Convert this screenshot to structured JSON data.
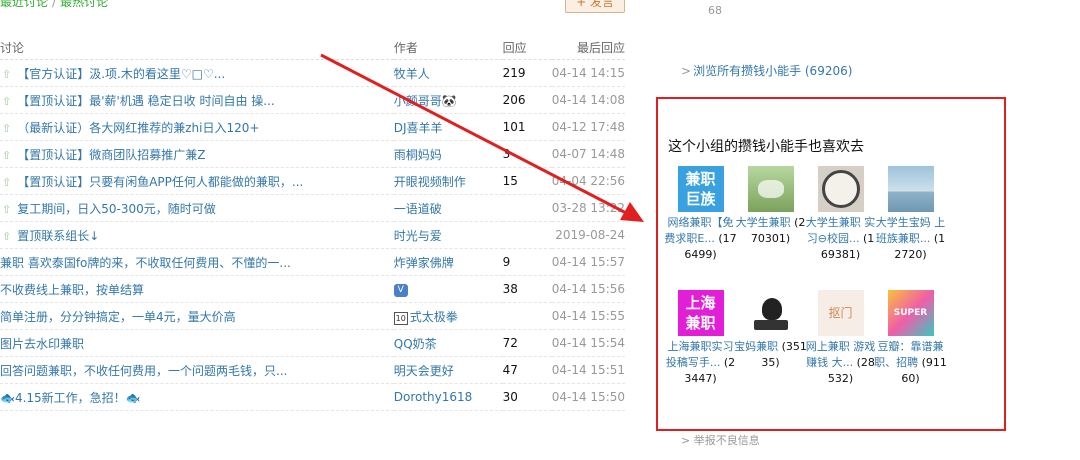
{
  "header": {
    "breadcrumb_recent": "最近讨论",
    "breadcrumb_sep": "/",
    "breadcrumb_hot": "最热讨论",
    "post_button": "+ 发言"
  },
  "table": {
    "columns": [
      "讨论",
      "作者",
      "回应",
      "最后回应"
    ],
    "rows": [
      {
        "pinned": true,
        "title": "【官方认证】汲.项.木的看这里♡□♡...",
        "author": "牧羊人",
        "replies": "219",
        "time": "04-14 14:15"
      },
      {
        "pinned": true,
        "title": "【置顶认证】最'薪'机遇 稳定日收 时间自由 操...",
        "author": "小颜哥哥🐼",
        "replies": "206",
        "time": "04-14 14:08"
      },
      {
        "pinned": true,
        "title": "（最新认证）各大网红推荐的兼zhi日入120+",
        "author": "DJ喜羊羊",
        "replies": "101",
        "time": "04-12 17:48"
      },
      {
        "pinned": true,
        "title": "【置顶认证】微商团队招募推广兼Z",
        "author": "雨桐妈妈",
        "replies": "3",
        "time": "04-07 14:48"
      },
      {
        "pinned": true,
        "title": "【置顶认证】只要有闲鱼APP任何人都能做的兼职，...",
        "author": "开眼视频制作",
        "replies": "15",
        "time": "04-04 22:56"
      },
      {
        "pinned": true,
        "title": "复工期间，日入50-300元，随时可做",
        "author": "一语道破",
        "replies": "",
        "time": "03-28 13:22"
      },
      {
        "pinned": true,
        "title": "置顶联系组长↓",
        "author": "时光与爱",
        "replies": "",
        "time": "2019-08-24"
      },
      {
        "pinned": false,
        "title": "兼职 喜欢泰国fo牌的来，不收取任何费用、不懂的一...",
        "author": "炸弹家佛牌",
        "replies": "9",
        "time": "04-14 15:57"
      },
      {
        "pinned": false,
        "title": "不收费线上兼职，按单结算",
        "author": "",
        "author_badge": "V",
        "replies": "38",
        "time": "04-14 15:56"
      },
      {
        "pinned": false,
        "title": "简单注册，分分钟搞定，一单4元，量大价高",
        "author": "式太极拳",
        "author_box": "10",
        "replies": "",
        "time": "04-14 15:55"
      },
      {
        "pinned": false,
        "title": "图片去水印兼职",
        "author": "QQ奶茶",
        "replies": "72",
        "time": "04-14 15:54"
      },
      {
        "pinned": false,
        "title": "回答问题兼职，不收任何费用，一个问题两毛钱，只...",
        "author": "明天会更好",
        "replies": "47",
        "time": "04-14 15:51"
      },
      {
        "pinned": false,
        "title": "🐟4.15新工作，急招！🐟",
        "author": "Dorothy1618",
        "replies": "30",
        "time": "04-14 15:50"
      }
    ]
  },
  "sidebar": {
    "top_count": "68",
    "browse_all": "浏览所有攒钱小能手 (69206)",
    "browse_arrow": ">",
    "rec_heading": "这个小组的攒钱小能手也喜欢去",
    "groups": [
      {
        "name": "网络兼职【免费求职E...",
        "count": "(176499)",
        "image_text": "兼职\n巨族",
        "icon": "group-logo-icon"
      },
      {
        "name": "大学生兼职",
        "count": "(270301)",
        "image_text": "",
        "icon": "landscape-photo-icon"
      },
      {
        "name": "大学生兼职 实习⊖校园...",
        "count": "(169381)",
        "image_text": "",
        "icon": "vinyl-disc-icon"
      },
      {
        "name": "大学生宝妈 上班族兼职...",
        "count": "(12720)",
        "image_text": "",
        "icon": "sea-photo-icon"
      },
      {
        "name": "上海兼职实习投稿写手...",
        "count": "(23447)",
        "image_text": "上海\n兼职",
        "icon": "group-logo-icon"
      },
      {
        "name": "宝妈兼职",
        "count": "(35135)",
        "image_text": "",
        "icon": "person-at-desk-icon"
      },
      {
        "name": "网上兼职 游戏赚钱 大...",
        "count": "(28532)",
        "image_text": "抠门",
        "icon": "cartoon-icon"
      },
      {
        "name": "豆瓣：靠谱兼职、招聘",
        "count": "(91160)",
        "image_text": "SUPER",
        "icon": "colorful-graphic-icon"
      }
    ],
    "report": "> 举报不良信息"
  },
  "colors": {
    "link": "#3377aa",
    "annotation_red": "#e02020"
  }
}
